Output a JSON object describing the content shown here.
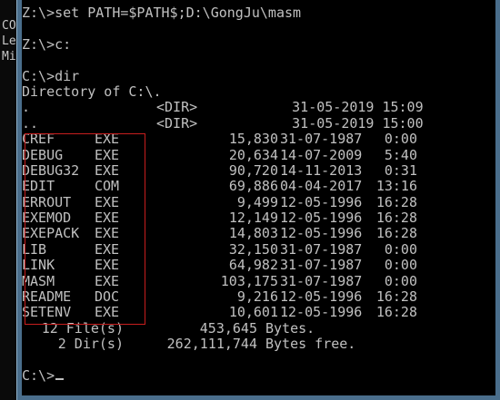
{
  "background_window": {
    "lines": [
      "CO",
      "Le",
      "Mi"
    ]
  },
  "console": {
    "cmd_set_path": "Z:\\>set PATH=$PATH$;D:\\GongJu\\masm",
    "cmd_change_drive": "Z:\\>c:",
    "cmd_dir": "C:\\>dir",
    "dir_header": "Directory of C:\\.",
    "dir_entries": [
      {
        "name": ".",
        "tag": "<DIR>",
        "date": "31-05-2019",
        "time": "15:09"
      },
      {
        "name": "..",
        "tag": "<DIR>",
        "date": "31-05-2019",
        "time": "15:00"
      }
    ],
    "files": [
      {
        "name": "CREF",
        "ext": "EXE",
        "size": "15,830",
        "date": "31-07-1987",
        "time": "0:00"
      },
      {
        "name": "DEBUG",
        "ext": "EXE",
        "size": "20,634",
        "date": "14-07-2009",
        "time": "5:40"
      },
      {
        "name": "DEBUG32",
        "ext": "EXE",
        "size": "90,720",
        "date": "14-11-2013",
        "time": "0:31"
      },
      {
        "name": "EDIT",
        "ext": "COM",
        "size": "69,886",
        "date": "04-04-2017",
        "time": "13:16"
      },
      {
        "name": "ERROUT",
        "ext": "EXE",
        "size": "9,499",
        "date": "12-05-1996",
        "time": "16:28"
      },
      {
        "name": "EXEMOD",
        "ext": "EXE",
        "size": "12,149",
        "date": "12-05-1996",
        "time": "16:28"
      },
      {
        "name": "EXEPACK",
        "ext": "EXE",
        "size": "14,803",
        "date": "12-05-1996",
        "time": "16:28"
      },
      {
        "name": "LIB",
        "ext": "EXE",
        "size": "32,150",
        "date": "31-07-1987",
        "time": "0:00"
      },
      {
        "name": "LINK",
        "ext": "EXE",
        "size": "64,982",
        "date": "31-07-1987",
        "time": "0:00"
      },
      {
        "name": "MASM",
        "ext": "EXE",
        "size": "103,175",
        "date": "31-07-1987",
        "time": "0:00"
      },
      {
        "name": "README",
        "ext": "DOC",
        "size": "9,216",
        "date": "12-05-1996",
        "time": "16:28"
      },
      {
        "name": "SETENV",
        "ext": "EXE",
        "size": "10,601",
        "date": "12-05-1996",
        "time": "16:28"
      }
    ],
    "summary_files": {
      "count": "12 File(s)",
      "bytes": "453,645",
      "suffix": "Bytes."
    },
    "summary_dirs": {
      "count": "2 Dir(s)",
      "bytes": "262,111,744",
      "suffix": "Bytes free."
    },
    "prompt": "C:\\>"
  },
  "colors": {
    "console_bg": "#000000",
    "console_fg": "#c0c0c0",
    "highlight_border": "#c81e1e",
    "window_frame": "#4a6e8c"
  }
}
